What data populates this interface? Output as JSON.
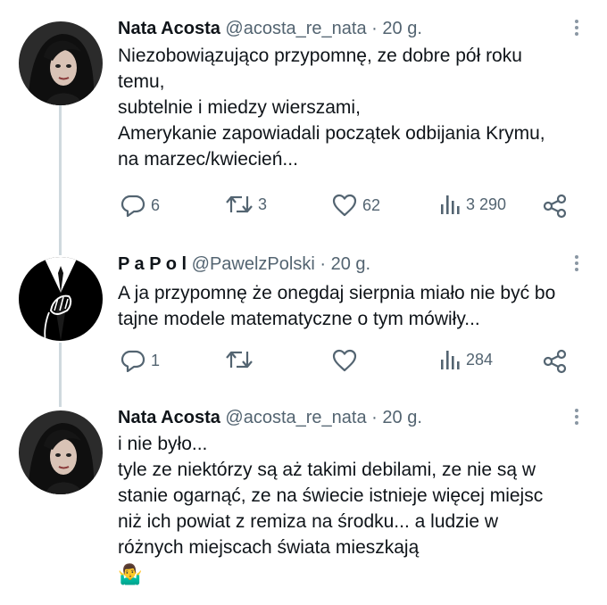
{
  "tweets": [
    {
      "name": "Nata Acosta",
      "handle": "@acosta_re_nata",
      "dot": "·",
      "time": "20 g.",
      "lines": [
        "Niezobowiązująco przypomnę, ze dobre pół roku",
        "temu,",
        "subtelnie i miedzy wierszami,",
        "Amerykanie zapowiadali początek odbijania Krymu,",
        "na marzec/kwiecień..."
      ],
      "replies": "6",
      "retweets": "3",
      "likes": "62",
      "views": "3 290"
    },
    {
      "name": "P a P o l",
      "handle": "@PawelzPolski",
      "dot": "·",
      "time": "20 g.",
      "lines": [
        "A ja przypomnę że onegdaj sierpnia miało nie być bo",
        "tajne modele matematyczne o tym mówiły..."
      ],
      "replies": "1",
      "retweets": "",
      "likes": "",
      "views": "284"
    },
    {
      "name": "Nata Acosta",
      "handle": "@acosta_re_nata",
      "dot": "·",
      "time": "20 g.",
      "lines": [
        "i nie było...",
        "tyle ze niektórzy są aż takimi debilami, ze nie są w",
        "stanie ogarnąć, ze na świecie istnieje więcej miejsc",
        "niż ich powiat z remiza na środku... a ludzie w",
        "różnych miejscach świata mieszkają"
      ],
      "emoji": "🤷‍♂️"
    }
  ],
  "colors": {
    "text": "#0f1419",
    "secondary": "#536471",
    "thread_line": "#cfd9de"
  },
  "icons": [
    "reply-icon",
    "retweet-icon",
    "like-icon",
    "views-icon",
    "share-icon",
    "more-icon"
  ]
}
